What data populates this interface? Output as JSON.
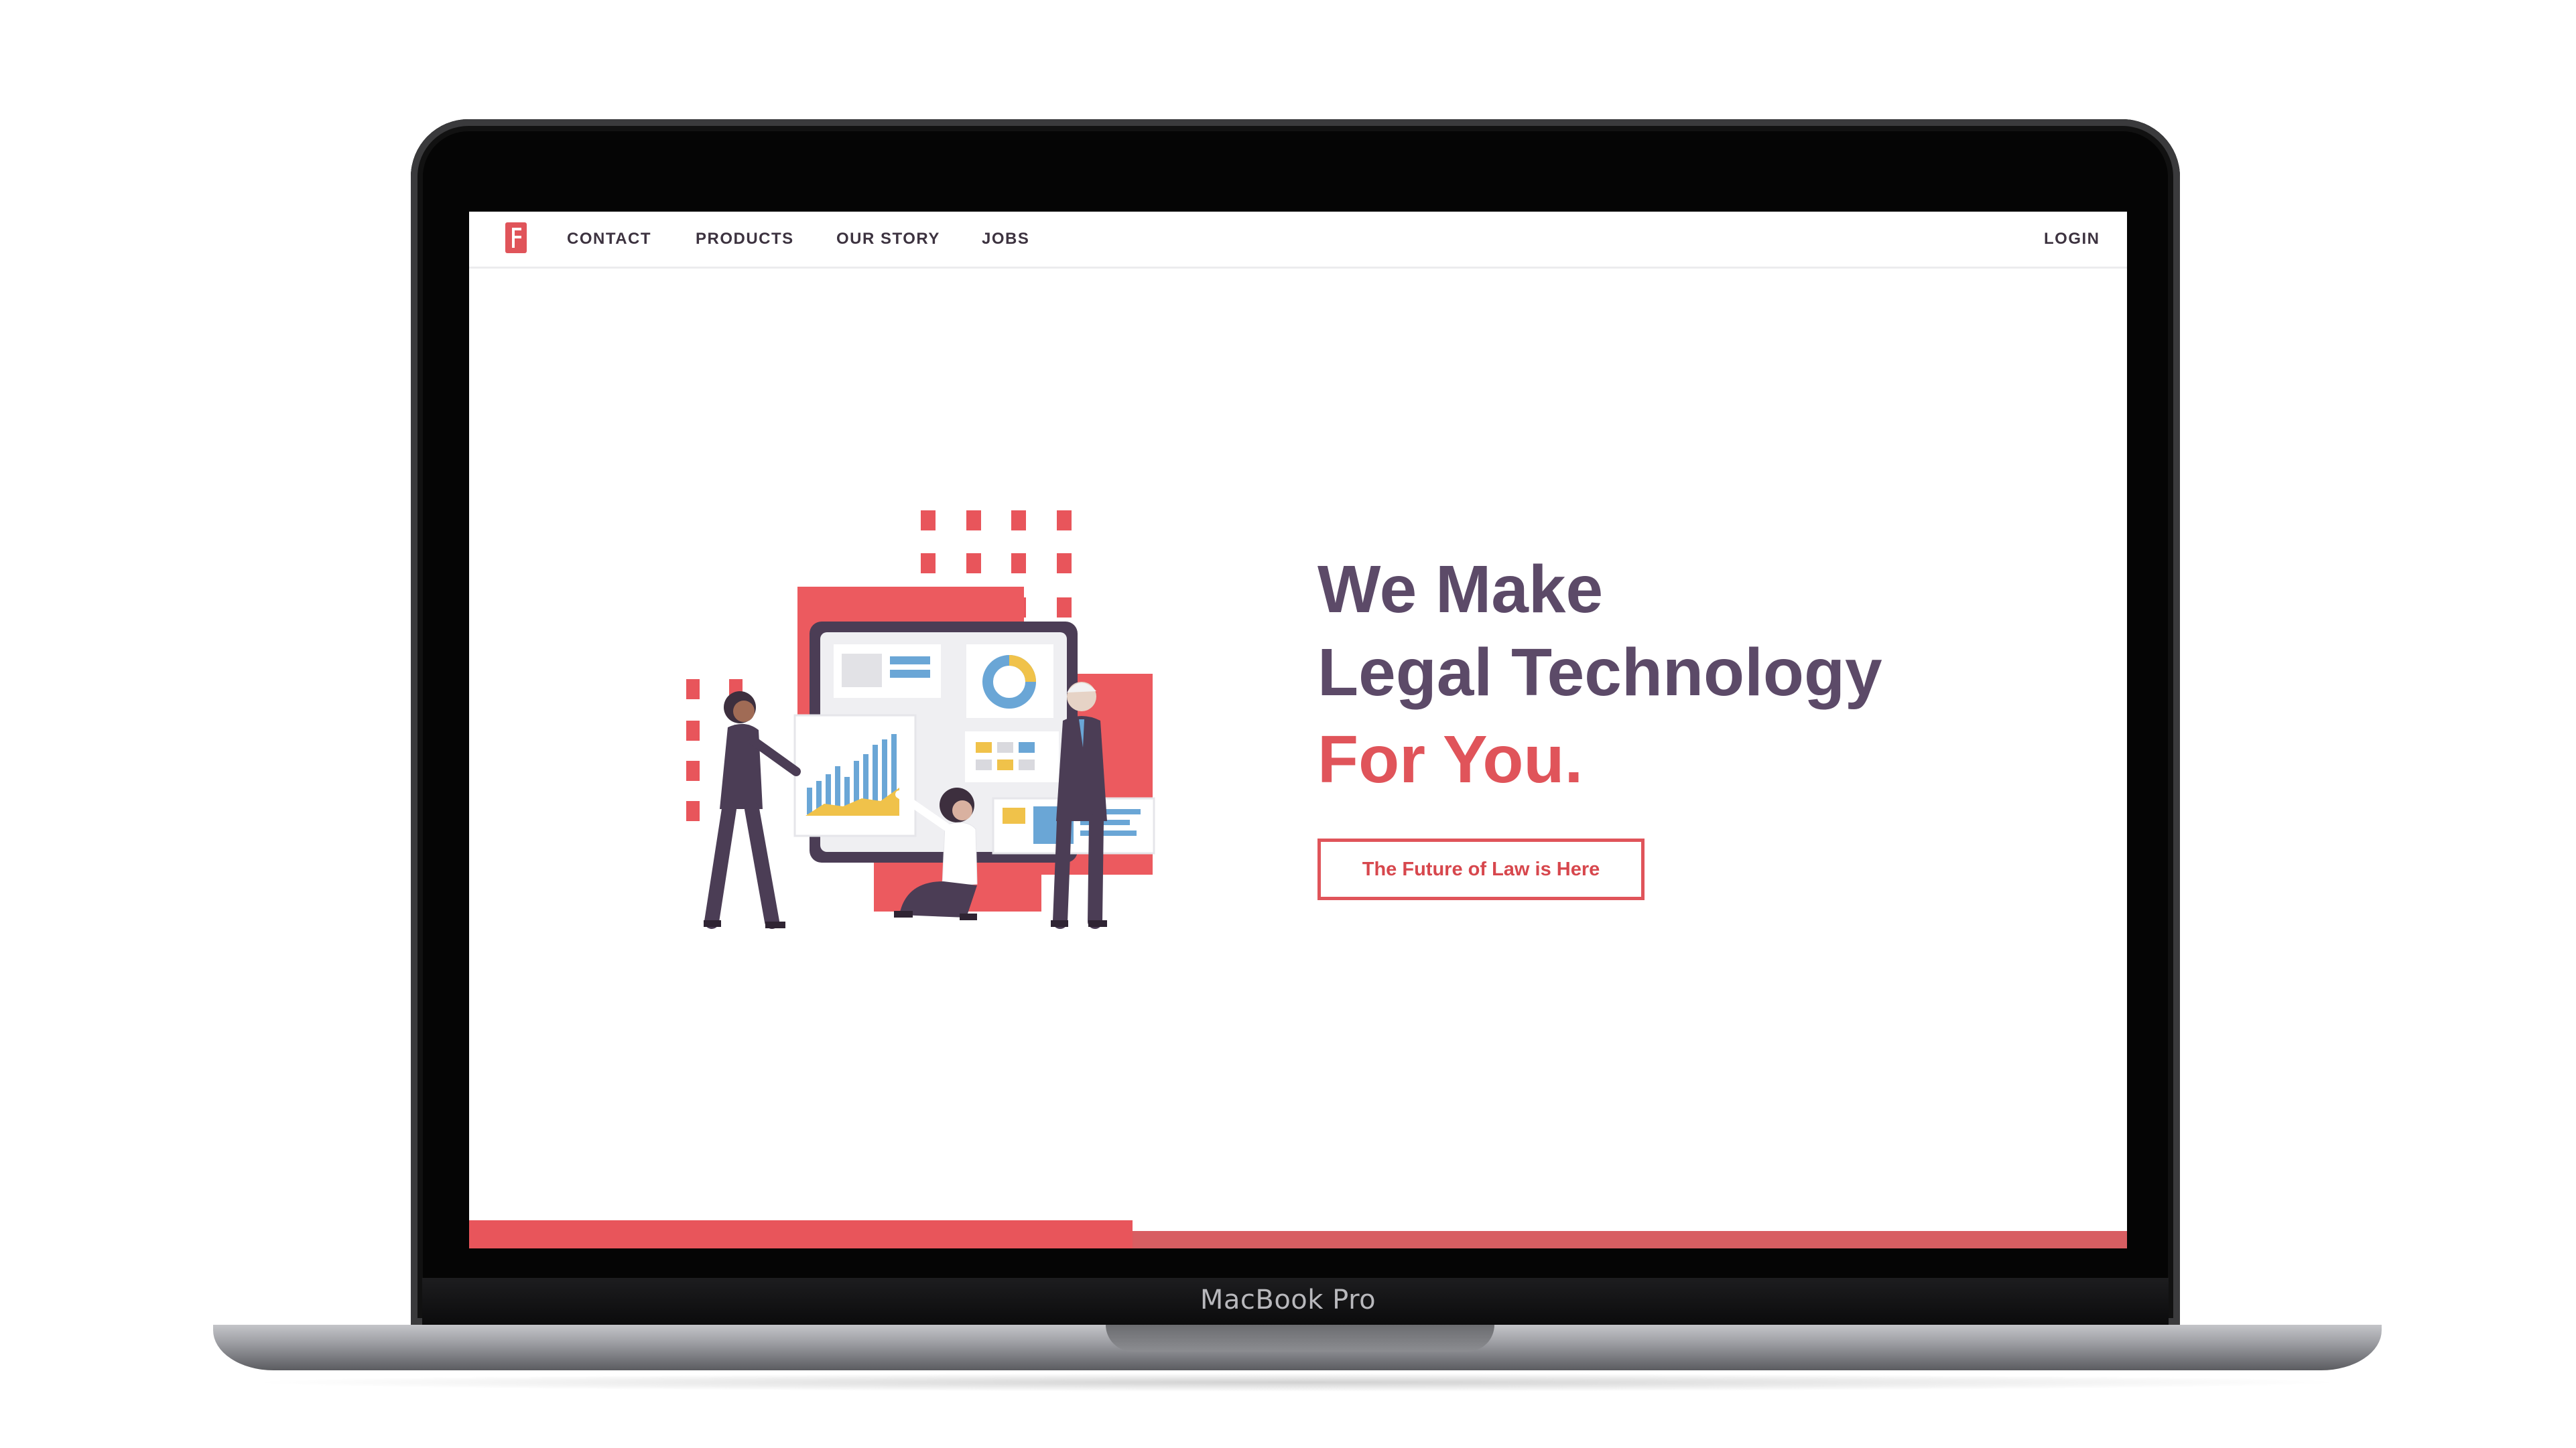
{
  "device": {
    "label": "MacBook Pro"
  },
  "nav": {
    "logo_icon": "firm-logo-icon",
    "items": [
      {
        "label": "CONTACT"
      },
      {
        "label": "PRODUCTS"
      },
      {
        "label": "OUR STORY"
      },
      {
        "label": "JOBS"
      }
    ],
    "login": "LOGIN"
  },
  "hero": {
    "headline_line1": "We Make",
    "headline_line2": "Legal Technology",
    "headline_line3": "For You.",
    "cta_label": "The Future of Law is Here",
    "illustration": "team-presenting-dashboard-illustration"
  },
  "colors": {
    "accent": "#e0545a",
    "headline": "#5c4a68",
    "nav_text": "#3d3340"
  }
}
